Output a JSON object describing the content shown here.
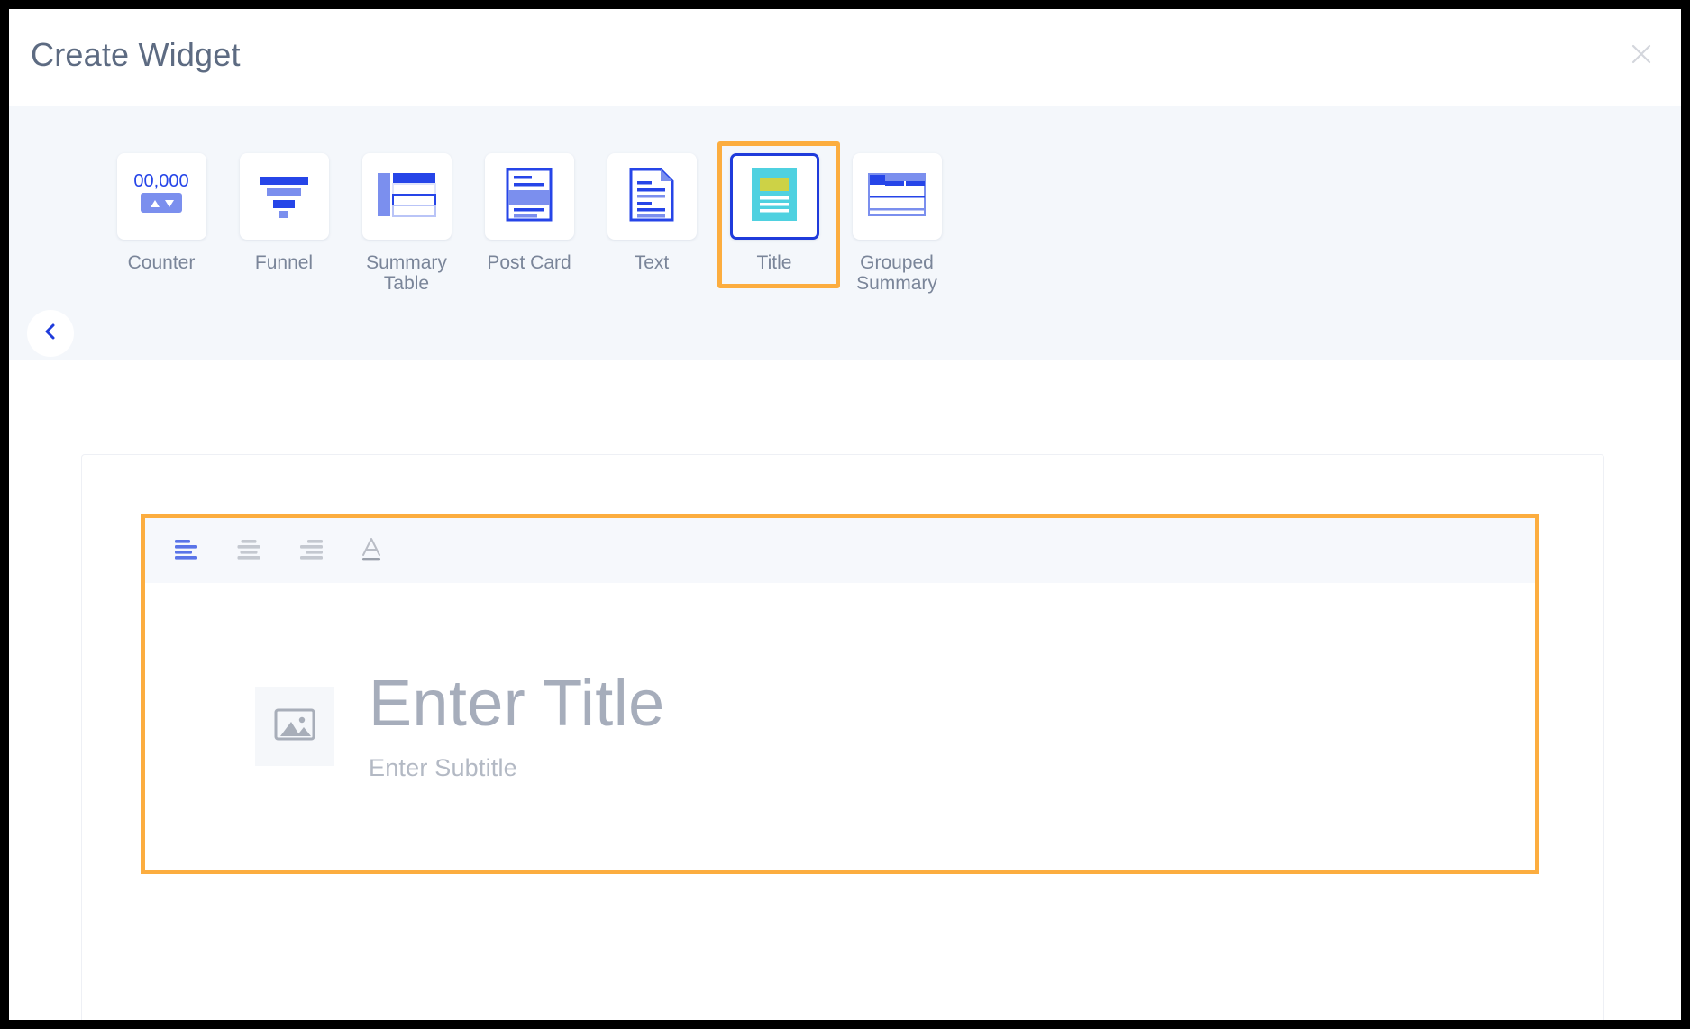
{
  "modal": {
    "title": "Create Widget",
    "close_icon": "close-icon",
    "close_label": "Close"
  },
  "picker": {
    "back_icon": "chevron-left-icon",
    "back_label": "Previous widgets",
    "items": [
      {
        "id": "counter",
        "label": "Counter",
        "icon": "counter-icon",
        "selected": false
      },
      {
        "id": "funnel",
        "label": "Funnel",
        "icon": "funnel-icon",
        "selected": false
      },
      {
        "id": "summary-table",
        "label": "Summary\nTable",
        "icon": "summary-table-icon",
        "selected": false
      },
      {
        "id": "post-card",
        "label": "Post Card",
        "icon": "post-card-icon",
        "selected": false
      },
      {
        "id": "text",
        "label": "Text",
        "icon": "text-icon",
        "selected": false
      },
      {
        "id": "title",
        "label": "Title",
        "icon": "title-icon",
        "selected": true
      },
      {
        "id": "grouped-summary",
        "label": "Grouped\nSummary",
        "icon": "grouped-summary-icon",
        "selected": false
      }
    ]
  },
  "editor": {
    "toolbar": [
      {
        "id": "align-left",
        "icon": "align-left-icon",
        "label": "Align left",
        "active": true
      },
      {
        "id": "align-center",
        "icon": "align-center-icon",
        "label": "Align center",
        "active": false
      },
      {
        "id": "align-right",
        "icon": "align-right-icon",
        "label": "Align right",
        "active": false
      },
      {
        "id": "font-color",
        "icon": "font-color-icon",
        "label": "Font color",
        "active": false
      }
    ],
    "image_placeholder_icon": "image-icon",
    "title_placeholder": "Enter Title",
    "subtitle_placeholder": "Enter Subtitle"
  },
  "colors": {
    "accent_blue": "#1f3bdb",
    "highlight_orange": "#fcad3f",
    "title_icon_cyan": "#4fd1e0",
    "title_icon_yellow": "#cdd246",
    "strip_background": "#f4f7fb",
    "text_gray": "#7a8599"
  }
}
